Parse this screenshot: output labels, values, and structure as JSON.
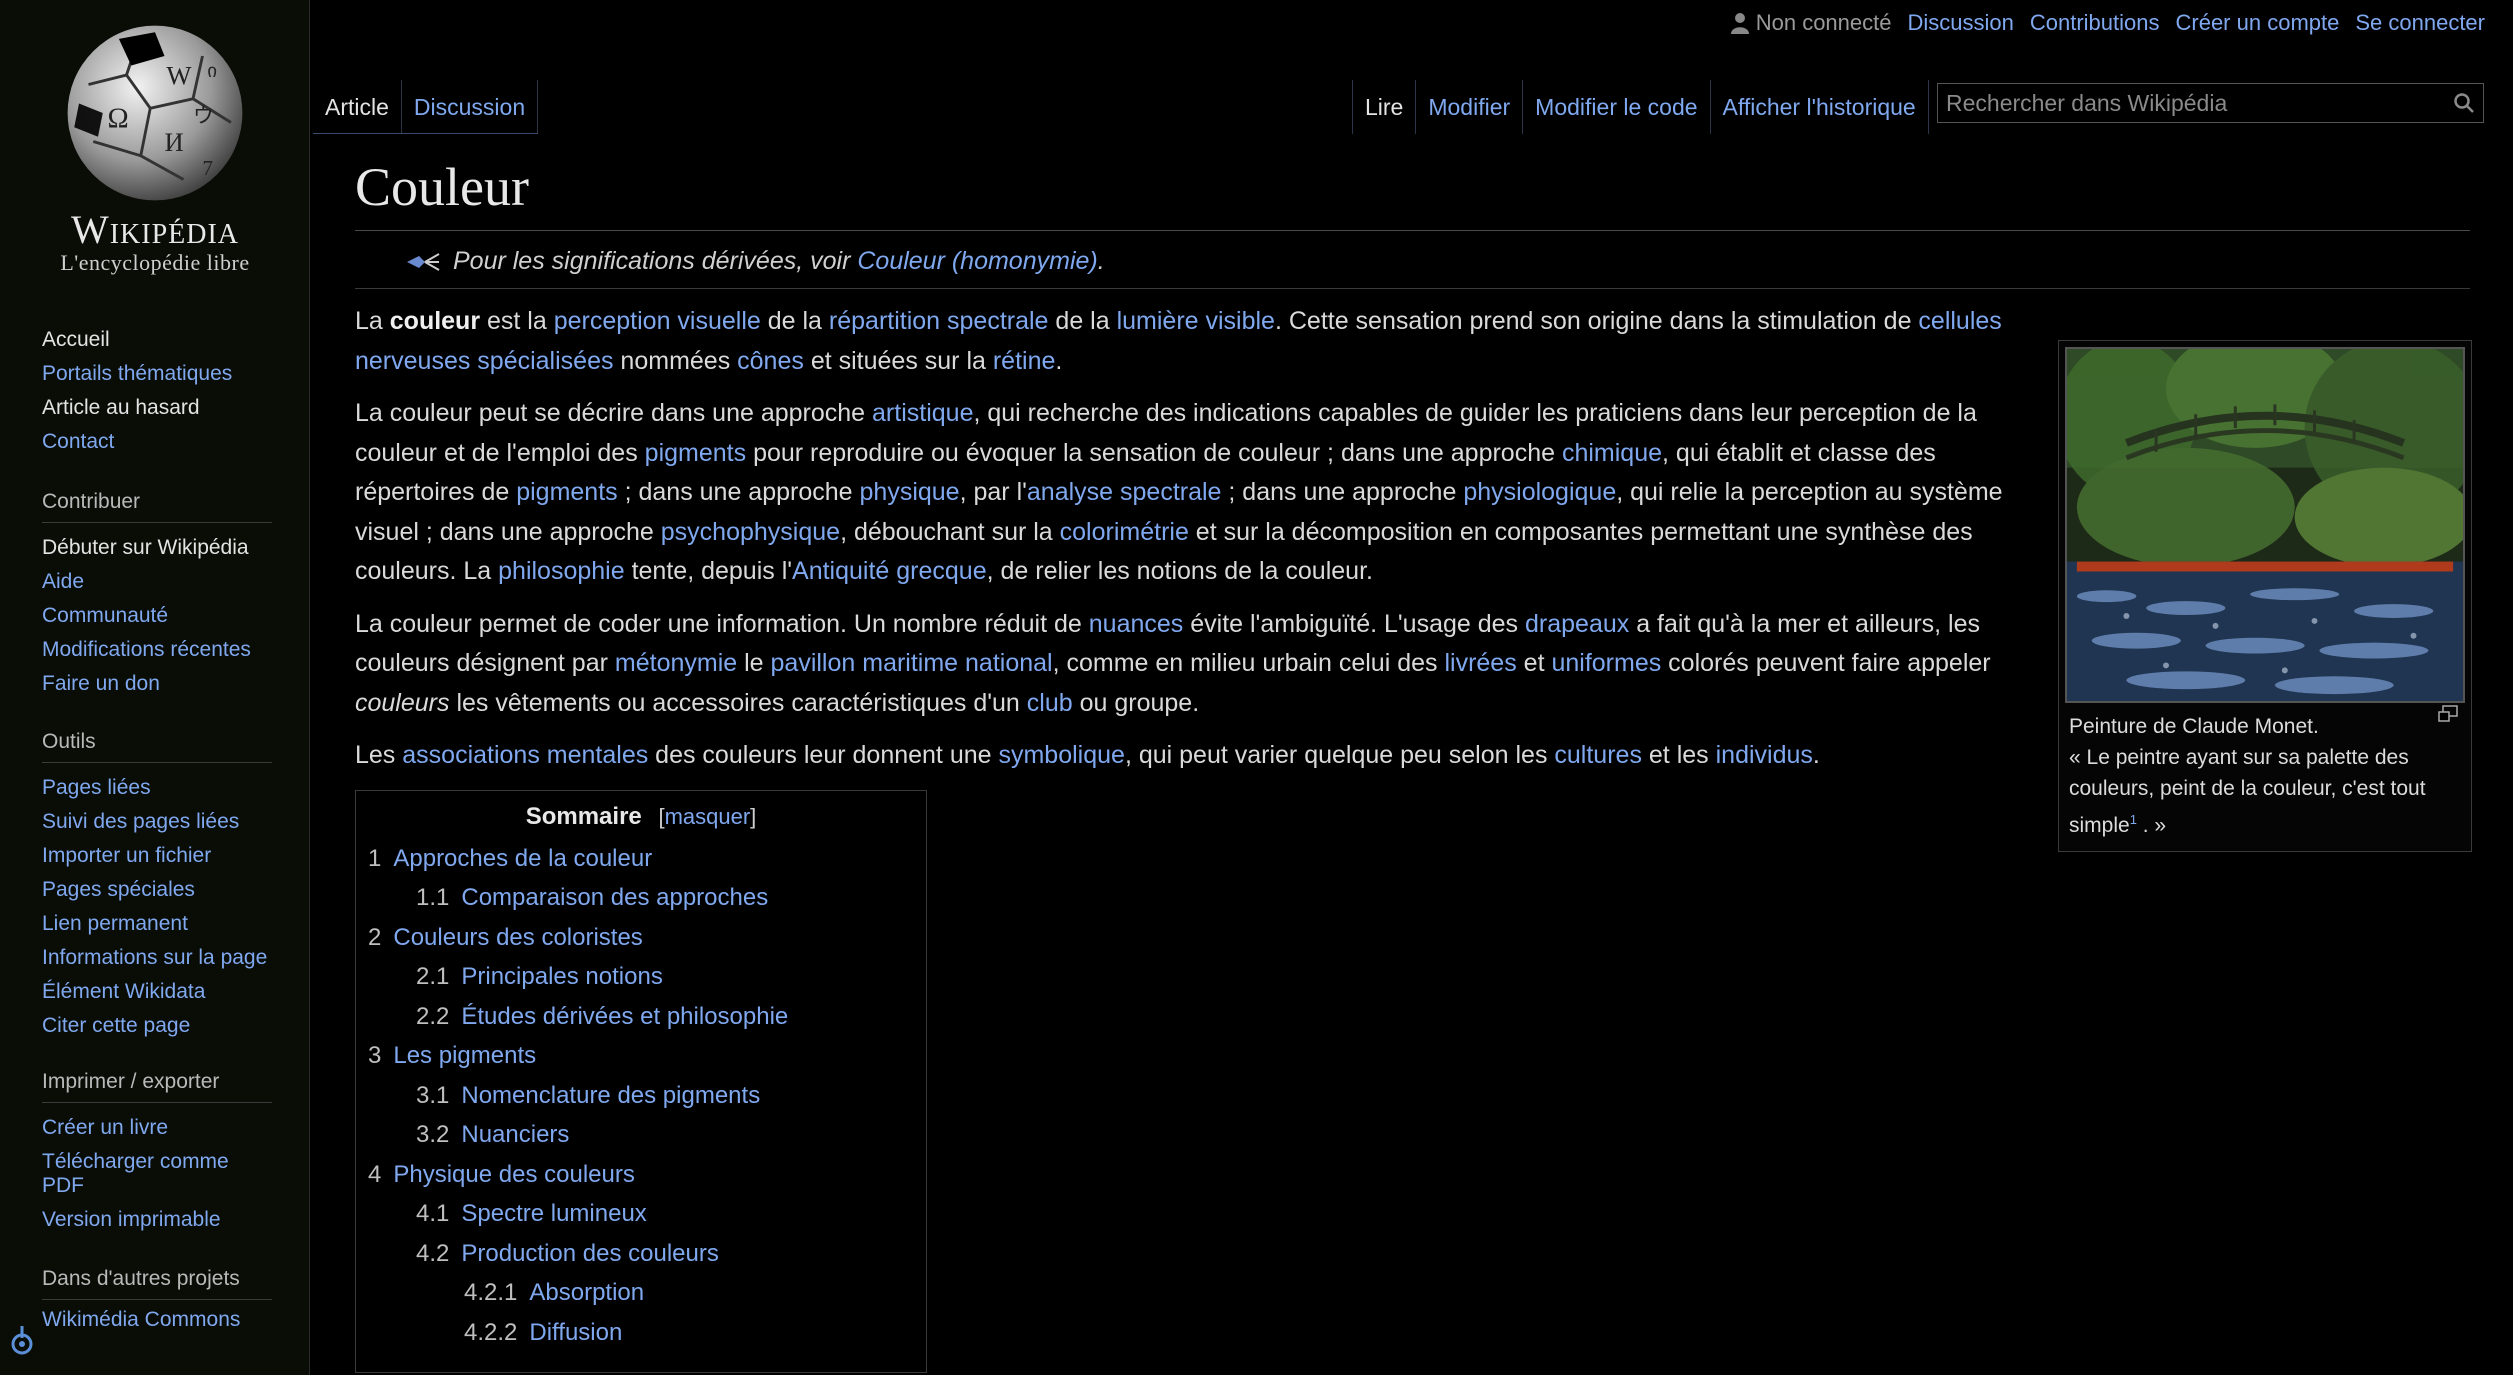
{
  "logo": {
    "wordmark": "Wikipédia",
    "tagline": "L'encyclopédie libre"
  },
  "sidebar": {
    "nav": [
      {
        "label": "Accueil",
        "plain": true
      },
      {
        "label": "Portails thématiques",
        "plain": false
      },
      {
        "label": "Article au hasard",
        "plain": true
      },
      {
        "label": "Contact",
        "plain": false
      }
    ],
    "contribuer": {
      "heading": "Contribuer",
      "items": [
        "Débuter sur Wikipédia",
        "Aide",
        "Communauté",
        "Modifications récentes",
        "Faire un don"
      ]
    },
    "outils": {
      "heading": "Outils",
      "items": [
        "Pages liées",
        "Suivi des pages liées",
        "Importer un fichier",
        "Pages spéciales",
        "Lien permanent",
        "Informations sur la page",
        "Élément Wikidata",
        "Citer cette page"
      ]
    },
    "imprimer": {
      "heading": "Imprimer / exporter",
      "items": [
        "Créer un livre",
        "Télécharger comme PDF",
        "Version imprimable"
      ]
    },
    "autres": {
      "heading": "Dans d'autres projets",
      "items": [
        "Wikimédia Commons"
      ]
    }
  },
  "personal": {
    "status": "Non connecté",
    "links": [
      "Discussion",
      "Contributions",
      "Créer un compte",
      "Se connecter"
    ]
  },
  "tabs": {
    "left": [
      "Article",
      "Discussion"
    ],
    "right": [
      "Lire",
      "Modifier",
      "Modifier le code",
      "Afficher l'historique"
    ]
  },
  "search": {
    "placeholder": "Rechercher dans Wikipédia"
  },
  "article": {
    "title": "Couleur",
    "hatnote_prefix": "Pour les significations dérivées, voir ",
    "hatnote_link": "Couleur (homonymie)",
    "hatnote_suffix": "."
  },
  "infobox": {
    "caption_line1": "Peinture de Claude Monet.",
    "caption_quote": "« Le peintre ayant sur sa palette des couleurs, peint de la couleur, c'est tout simple",
    "caption_ref": "1",
    "caption_end": ". »"
  },
  "toc": {
    "title": "Sommaire",
    "toggle": "[masquer]",
    "items": [
      {
        "num": "1",
        "label": "Approches de la couleur",
        "level": 1
      },
      {
        "num": "1.1",
        "label": "Comparaison des approches",
        "level": 2
      },
      {
        "num": "2",
        "label": "Couleurs des coloristes",
        "level": 1
      },
      {
        "num": "2.1",
        "label": "Principales notions",
        "level": 2
      },
      {
        "num": "2.2",
        "label": "Études dérivées et philosophie",
        "level": 2
      },
      {
        "num": "3",
        "label": "Les pigments",
        "level": 1
      },
      {
        "num": "3.1",
        "label": "Nomenclature des pigments",
        "level": 2
      },
      {
        "num": "3.2",
        "label": "Nuanciers",
        "level": 2
      },
      {
        "num": "4",
        "label": "Physique des couleurs",
        "level": 1
      },
      {
        "num": "4.1",
        "label": "Spectre lumineux",
        "level": 2
      },
      {
        "num": "4.2",
        "label": "Production des couleurs",
        "level": 2
      },
      {
        "num": "4.2.1",
        "label": "Absorption",
        "level": 3
      },
      {
        "num": "4.2.2",
        "label": "Diffusion",
        "level": 3
      }
    ]
  },
  "paragraphs": [
    [
      {
        "t": "La "
      },
      {
        "b": "couleur"
      },
      {
        "t": " est la "
      },
      {
        "l": "perception visuelle"
      },
      {
        "t": " de la "
      },
      {
        "l": "répartition spectrale"
      },
      {
        "t": " de la "
      },
      {
        "l": "lumière visible"
      },
      {
        "t": ". Cette sensation prend son origine dans la stimulation de "
      },
      {
        "l": "cellules nerveuses spécialisées"
      },
      {
        "t": " nommées "
      },
      {
        "l": "cônes"
      },
      {
        "t": " et situées sur la "
      },
      {
        "l": "rétine"
      },
      {
        "t": "."
      }
    ],
    [
      {
        "t": "La couleur peut se décrire dans une approche "
      },
      {
        "l": "artistique"
      },
      {
        "t": ", qui recherche des indications capables de guider les praticiens dans leur perception de la couleur et de l'emploi des "
      },
      {
        "l": "pigments"
      },
      {
        "t": " pour reproduire ou évoquer la sensation de couleur ; dans une approche "
      },
      {
        "l": "chimique"
      },
      {
        "t": ", qui établit et classe des répertoires de "
      },
      {
        "l": "pigments"
      },
      {
        "t": " ; dans une approche "
      },
      {
        "l": "physique"
      },
      {
        "t": ", par l'"
      },
      {
        "l": "analyse spectrale"
      },
      {
        "t": " ; dans une approche "
      },
      {
        "l": "physiologique"
      },
      {
        "t": ", qui relie la perception au système visuel ; dans une approche "
      },
      {
        "l": "psychophysique"
      },
      {
        "t": ", débouchant sur la "
      },
      {
        "l": "colorimétrie"
      },
      {
        "t": " et sur la décomposition en composantes permettant une synthèse des couleurs. La "
      },
      {
        "l": "philosophie"
      },
      {
        "t": " tente, depuis l'"
      },
      {
        "l": "Antiquité grecque"
      },
      {
        "t": ", de relier les notions de la couleur."
      }
    ],
    [
      {
        "t": "La couleur permet de coder une information. Un nombre réduit de "
      },
      {
        "l": "nuances"
      },
      {
        "t": " évite l'ambiguïté. L'usage des "
      },
      {
        "l": "drapeaux"
      },
      {
        "t": " a fait qu'à la mer et ailleurs, les couleurs désignent par "
      },
      {
        "l": "métonymie"
      },
      {
        "t": " le "
      },
      {
        "l": "pavillon maritime national"
      },
      {
        "t": ", comme en milieu urbain celui des "
      },
      {
        "l": "livrées"
      },
      {
        "t": " et "
      },
      {
        "l": "uniformes"
      },
      {
        "t": " colorés peuvent faire appeler "
      },
      {
        "i": "couleurs"
      },
      {
        "t": " les vêtements ou accessoires caractéristiques d'un "
      },
      {
        "l": "club"
      },
      {
        "t": " ou groupe."
      }
    ],
    [
      {
        "t": "Les "
      },
      {
        "l": "associations mentales"
      },
      {
        "t": " des couleurs leur donnent une "
      },
      {
        "l": "symbolique"
      },
      {
        "t": ", qui peut varier quelque peu selon les "
      },
      {
        "l": "cultures"
      },
      {
        "t": " et les "
      },
      {
        "l": "individus"
      },
      {
        "t": "."
      }
    ]
  ],
  "colors": {
    "link": "#7fa8ef",
    "background": "#000000",
    "text": "#dadada"
  }
}
